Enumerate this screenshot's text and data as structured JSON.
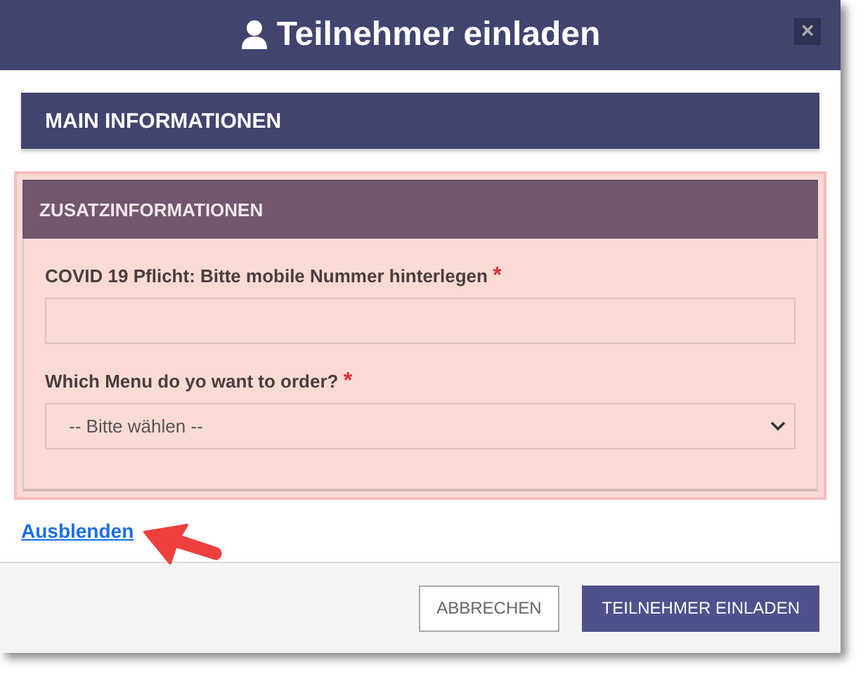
{
  "dialog": {
    "title": "Teilnehmer einladen",
    "close": "×"
  },
  "main_section": {
    "title": "MAIN INFORMATIONEN"
  },
  "extra_section": {
    "title": "ZUSATZINFORMATIONEN",
    "fields": [
      {
        "kind": "text",
        "label": "COVID 19 Pflicht: Bitte mobile Nummer hinterlegen",
        "required_mark": "*"
      },
      {
        "kind": "select",
        "label": "Which Menu do yo want to order?",
        "required_mark": "*",
        "value": "-- Bitte wählen --"
      }
    ]
  },
  "toggle_link": "Ausblenden",
  "buttons": [
    {
      "kind": "secondary",
      "label": "ABBRECHEN"
    },
    {
      "kind": "primary",
      "label": "TEILNEHMER EINLADEN"
    }
  ]
}
